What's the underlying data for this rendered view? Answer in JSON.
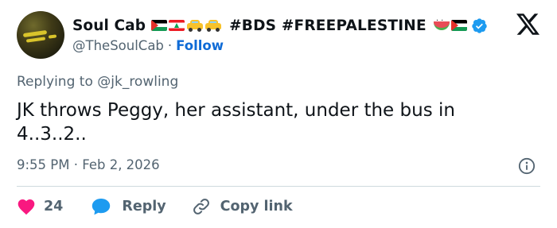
{
  "author": {
    "display_name": "Soul Cab",
    "hashtags": "#BDS #FREEPALESTINE",
    "handle": "@TheSoulCab",
    "separator": "·",
    "follow_label": "Follow",
    "avatar_icon": "avatar-image",
    "emoji_icons": [
      "palestine-flag-icon",
      "lebanon-flag-icon",
      "taxi-icon",
      "taxi-icon",
      "watermelon-icon",
      "palestine-flag-icon",
      "verified-badge-icon"
    ],
    "verified_color": "#1d9bf0"
  },
  "platform_logo": "x-logo-icon",
  "replying": {
    "prefix": "Replying to",
    "target": "@jk_rowling"
  },
  "tweet": {
    "text": "JK throws Peggy, her assistant, under the bus in 4..3..2.."
  },
  "meta": {
    "time": "9:55 PM",
    "separator": "·",
    "date": "Feb 2, 2026",
    "info_icon": "info-icon"
  },
  "actions": {
    "like_count": "24",
    "reply_label": "Reply",
    "copy_link_label": "Copy link",
    "like_color": "#f91880",
    "reply_color": "#1d9bf0"
  },
  "colors": {
    "text_primary": "#0f1419",
    "text_secondary": "#536471",
    "link": "#0f6bd6",
    "divider": "#cfd9de"
  }
}
